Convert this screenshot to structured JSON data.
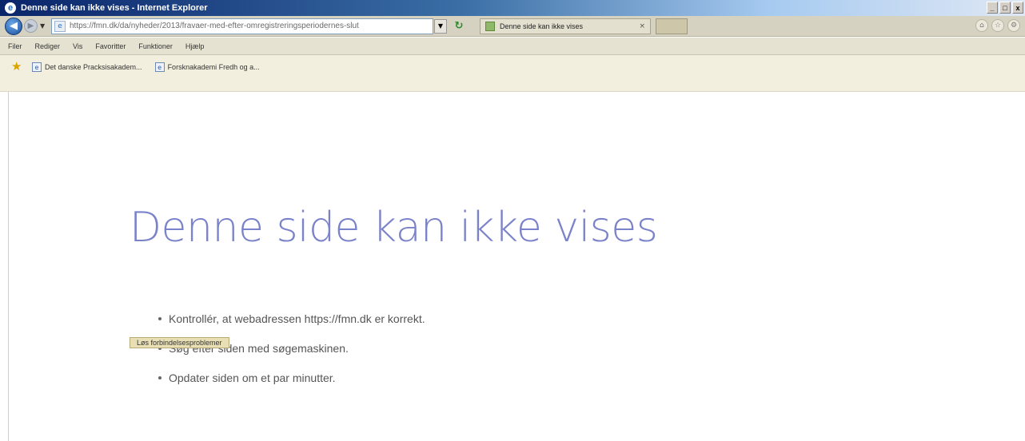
{
  "window": {
    "title": "Denne side kan ikke vises - Internet Explorer",
    "controls": {
      "minimize": "_",
      "maximize": "□",
      "close": "x"
    }
  },
  "navbar": {
    "address_url": "https://fmn.dk/da/nyheder/2013/fravaer-med-efter-omregistreringsperiodernes-slut",
    "tab_label": "Denne side kan ikke vises",
    "tab_close": "×"
  },
  "menu": {
    "items": [
      "Filer",
      "Rediger",
      "Vis",
      "Favoritter",
      "Funktioner",
      "Hjælp"
    ]
  },
  "favorites": {
    "items": [
      "Det danske Pracksisakadem...",
      "Forsknakademi Fredh og a..."
    ]
  },
  "content": {
    "heading": "Denne side kan ikke vises",
    "bullets": [
      "Kontrollér, at webadressen https://fmn.dk er korrekt.",
      "Søg efter siden med søgemaskinen.",
      "Opdater siden om et par minutter."
    ],
    "fix_button": "Løs forbindelsesproblemer"
  },
  "colors": {
    "heading": "#7a82c9",
    "titlebar_start": "#0a246a"
  }
}
